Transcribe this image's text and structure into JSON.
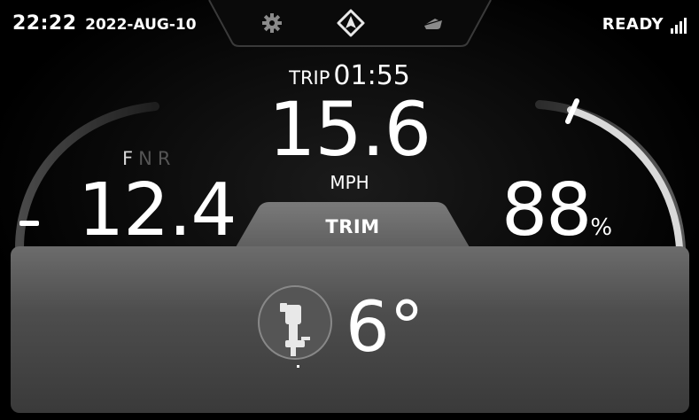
{
  "header": {
    "time": "22:22",
    "date": "2022-AUG-10",
    "status": "READY",
    "signal_icon": "signal-bars-icon",
    "nav_icons": [
      "settings-gear-icon",
      "navigation-arrow-icon",
      "boat-icon"
    ]
  },
  "trip": {
    "label": "TRIP",
    "time": "01:55"
  },
  "speed": {
    "value": "15.6",
    "unit": "MPH"
  },
  "gear": {
    "f": "F",
    "n": "N",
    "r": "R",
    "active": "F"
  },
  "left_gauge": {
    "value": "12.4"
  },
  "right_gauge": {
    "value": "88",
    "unit": "%",
    "level_percent": 88
  },
  "trim": {
    "label": "TRIM",
    "value": "6°",
    "icon": "outboard-motor-icon"
  },
  "colors": {
    "background": "#000000",
    "text": "#ffffff",
    "panel": "#4d4d4d",
    "inactive": "#555555"
  }
}
